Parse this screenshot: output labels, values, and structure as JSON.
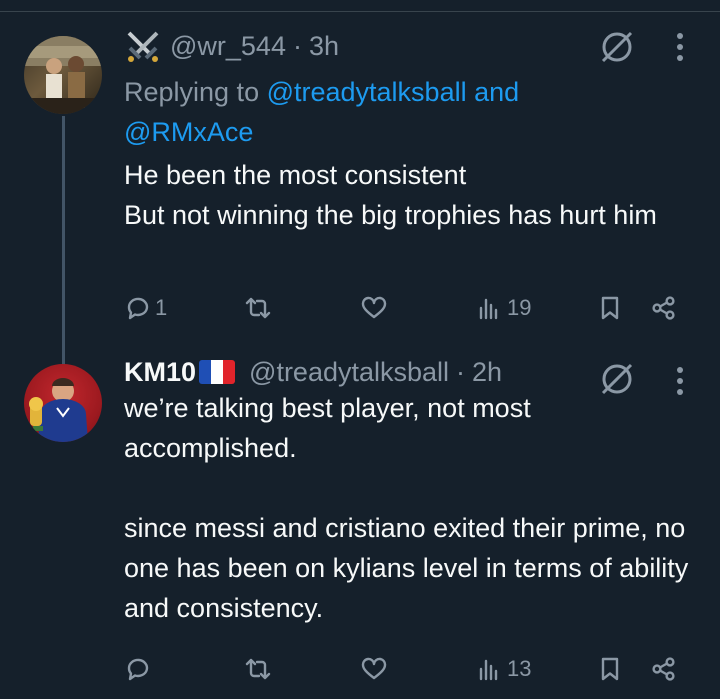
{
  "colors": {
    "background": "#15202b",
    "text_primary": "#f7f9f9",
    "text_secondary": "#8b98a5",
    "link": "#1d9bf0",
    "thread_line": "#425466"
  },
  "tweets": [
    {
      "avatar": "avatar-photo-two-people",
      "display_name": "",
      "name_icon": "crossed-swords-icon",
      "handle": "@wr_544",
      "dot": "·",
      "time": "3h",
      "replying_to": {
        "prefix": "Replying to ",
        "mention1": "@treadytalksball",
        "joiner": " and",
        "mention2": "@RMxAce"
      },
      "body": [
        "He been the most consistent",
        "But not winning the big trophies has hurt him"
      ],
      "actions": {
        "reply": "1",
        "retweet": "",
        "like": "",
        "views": "19"
      }
    },
    {
      "avatar": "avatar-player-with-trophy",
      "display_name": "KM10",
      "name_icon": "france-flag-icon",
      "handle": "@treadytalksball",
      "dot": "·",
      "time": "2h",
      "body": [
        "we’re talking best player, not most accomplished.",
        "",
        "since messi and cristiano exited their prime, no one has been on kylians level in terms of ability and consistency."
      ],
      "actions": {
        "reply": "",
        "retweet": "",
        "like": "",
        "views": "13"
      }
    }
  ]
}
